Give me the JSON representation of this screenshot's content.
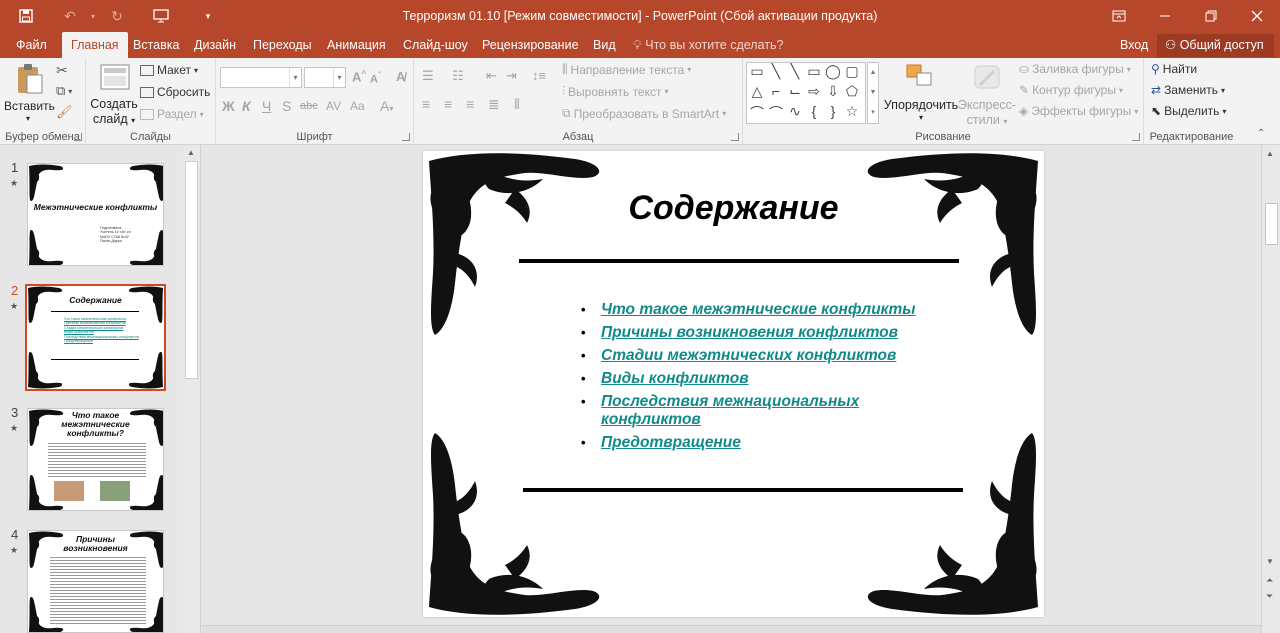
{
  "window": {
    "title": "Терроризм 01.10 [Режим совместимости] - PowerPoint (Сбой активации продукта)"
  },
  "tabs": {
    "file": "Файл",
    "items": [
      "Главная",
      "Вставка",
      "Дизайн",
      "Переходы",
      "Анимация",
      "Слайд-шоу",
      "Рецензирование",
      "Вид"
    ],
    "active": "Главная",
    "tell_me": "Что вы хотите сделать?",
    "login": "Вход",
    "share": "Общий доступ"
  },
  "ribbon": {
    "clipboard": {
      "label": "Буфер обмена",
      "paste": "Вставить"
    },
    "slides": {
      "label": "Слайды",
      "new_slide_1": "Создать",
      "new_slide_2": "слайд",
      "layout": "Макет",
      "reset": "Сбросить",
      "section": "Раздел"
    },
    "font": {
      "label": "Шрифт"
    },
    "paragraph": {
      "label": "Абзац",
      "text_direction": "Направление текста",
      "align_text": "Выровнять текст",
      "smartart": "Преобразовать в SmartArt"
    },
    "drawing": {
      "label": "Рисование",
      "arrange": "Упорядочить",
      "quick_styles_1": "Экспресс-",
      "quick_styles_2": "стили",
      "shape_fill": "Заливка фигуры",
      "shape_outline": "Контур фигуры",
      "shape_effects": "Эффекты фигуры"
    },
    "editing": {
      "label": "Редактирование",
      "find": "Найти",
      "replace": "Заменить",
      "select": "Выделить"
    }
  },
  "thumbnails": [
    {
      "num": "1",
      "title": "Межэтнические конфликты",
      "lines": [
        "Подготовила",
        "Учитель 10 «А» кл",
        "МАОУ СОШ №42",
        "Панас Дарья"
      ]
    },
    {
      "num": "2",
      "title": "Содержание",
      "lines": [
        "Что такое межэтнические конфликты",
        "Причины возникновения конфликтов",
        "Стадии межэтнических конфликтов",
        "Виды конфликтов",
        "Последствия межнациональных конфликтов",
        "Предотвращение"
      ]
    },
    {
      "num": "3",
      "title_1": "Что такое",
      "title_2": "межэтнические",
      "title_3": "конфликты?"
    },
    {
      "num": "4",
      "title_1": "Причины",
      "title_2": "возникновения"
    }
  ],
  "slide": {
    "title": "Содержание",
    "items": [
      "Что такое межэтнические конфликты",
      "Причины возникновения конфликтов",
      "Стадии межэтнических конфликтов",
      "Виды конфликтов",
      "Последствия межнациональных конфликтов",
      "Предотвращение"
    ]
  },
  "colors": {
    "accent": "#b7472a",
    "link": "#108a8a",
    "selected_thumb_border": "#d24726"
  }
}
